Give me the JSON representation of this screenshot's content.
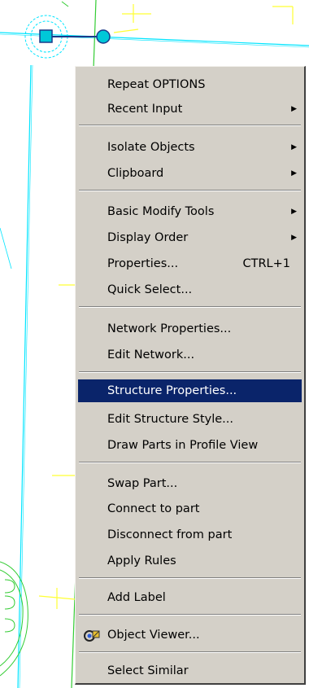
{
  "colors": {
    "menu_bg": "#d4d0c8",
    "highlight": "#0a246a",
    "highlight_text": "#ffffff",
    "cad_cyan": "#00e5ff",
    "cad_green": "#33cc33",
    "cad_yellow": "#ffff33"
  },
  "menu": {
    "items": [
      {
        "label": "Repeat OPTIONS",
        "shortcut": "",
        "submenu": false
      },
      {
        "label": "Recent Input",
        "shortcut": "",
        "submenu": true
      },
      {
        "label": "Isolate Objects",
        "shortcut": "",
        "submenu": true
      },
      {
        "label": "Clipboard",
        "shortcut": "",
        "submenu": true
      },
      {
        "label": "Basic Modify Tools",
        "shortcut": "",
        "submenu": true
      },
      {
        "label": "Display Order",
        "shortcut": "",
        "submenu": true
      },
      {
        "label": "Properties...",
        "shortcut": "CTRL+1",
        "submenu": false
      },
      {
        "label": "Quick Select...",
        "shortcut": "",
        "submenu": false
      },
      {
        "label": "Network Properties...",
        "shortcut": "",
        "submenu": false
      },
      {
        "label": "Edit Network...",
        "shortcut": "",
        "submenu": false
      },
      {
        "label": "Structure Properties...",
        "shortcut": "",
        "submenu": false,
        "highlighted": true
      },
      {
        "label": "Edit Structure Style...",
        "shortcut": "",
        "submenu": false
      },
      {
        "label": "Draw Parts in Profile View",
        "shortcut": "",
        "submenu": false
      },
      {
        "label": "Swap Part...",
        "shortcut": "",
        "submenu": false
      },
      {
        "label": "Connect to part",
        "shortcut": "",
        "submenu": false
      },
      {
        "label": "Disconnect from part",
        "shortcut": "",
        "submenu": false
      },
      {
        "label": "Apply Rules",
        "shortcut": "",
        "submenu": false
      },
      {
        "label": "Add Label",
        "shortcut": "",
        "submenu": false
      },
      {
        "label": "Object Viewer...",
        "shortcut": "",
        "submenu": false,
        "icon": "object-viewer-icon"
      },
      {
        "label": "Select Similar",
        "shortcut": "",
        "submenu": false
      }
    ]
  }
}
